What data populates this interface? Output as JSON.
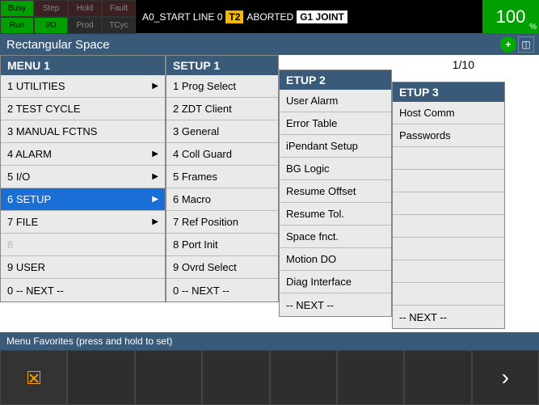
{
  "status": {
    "busy": "Busy",
    "step": "Step",
    "hold": "Hold",
    "fault": "Fault",
    "run": "Run",
    "io": "I/O",
    "prod": "Prod",
    "tcyc": "TCyc"
  },
  "program_line": "A0_START LINE 0",
  "mode_badge": "T2",
  "state": "ABORTED",
  "coord_badge": "G1 JOINT",
  "override": "100",
  "override_unit": "%",
  "title": "Rectangular Space",
  "pager": "1/10",
  "menu1": {
    "header": "MENU  1",
    "items": [
      {
        "label": "1 UTILITIES",
        "arrow": true
      },
      {
        "label": "2 TEST CYCLE"
      },
      {
        "label": "3 MANUAL FCTNS"
      },
      {
        "label": "4 ALARM",
        "arrow": true
      },
      {
        "label": "5 I/O",
        "arrow": true
      },
      {
        "label": "6 SETUP",
        "arrow": true,
        "selected": true
      },
      {
        "label": "7 FILE",
        "arrow": true
      },
      {
        "label": "8",
        "disabled": true
      },
      {
        "label": "9 USER"
      },
      {
        "label": "0 -- NEXT --"
      }
    ]
  },
  "menu2": {
    "header": "SETUP  1",
    "items": [
      {
        "label": "1 Prog Select"
      },
      {
        "label": "2 ZDT Client"
      },
      {
        "label": "3 General"
      },
      {
        "label": "4 Coll Guard"
      },
      {
        "label": "5 Frames"
      },
      {
        "label": "6 Macro"
      },
      {
        "label": "7 Ref Position"
      },
      {
        "label": "8 Port Init"
      },
      {
        "label": "9 Ovrd Select"
      },
      {
        "label": "0 -- NEXT --"
      }
    ]
  },
  "menu3": {
    "header": "ETUP  2",
    "items": [
      {
        "label": "User Alarm"
      },
      {
        "label": "Error Table"
      },
      {
        "label": "iPendant Setup"
      },
      {
        "label": "BG Logic"
      },
      {
        "label": "Resume Offset"
      },
      {
        "label": "Resume Tol."
      },
      {
        "label": "Space fnct."
      },
      {
        "label": "Motion DO"
      },
      {
        "label": "Diag Interface"
      },
      {
        "label": "-- NEXT --"
      }
    ]
  },
  "menu4": {
    "header": "ETUP  3",
    "items": [
      {
        "label": "Host Comm"
      },
      {
        "label": "Passwords"
      },
      {
        "label": ""
      },
      {
        "label": ""
      },
      {
        "label": ""
      },
      {
        "label": ""
      },
      {
        "label": ""
      },
      {
        "label": ""
      },
      {
        "label": ""
      },
      {
        "label": "-- NEXT --"
      }
    ]
  },
  "hint": "Menu Favorites (press and hold to set)"
}
